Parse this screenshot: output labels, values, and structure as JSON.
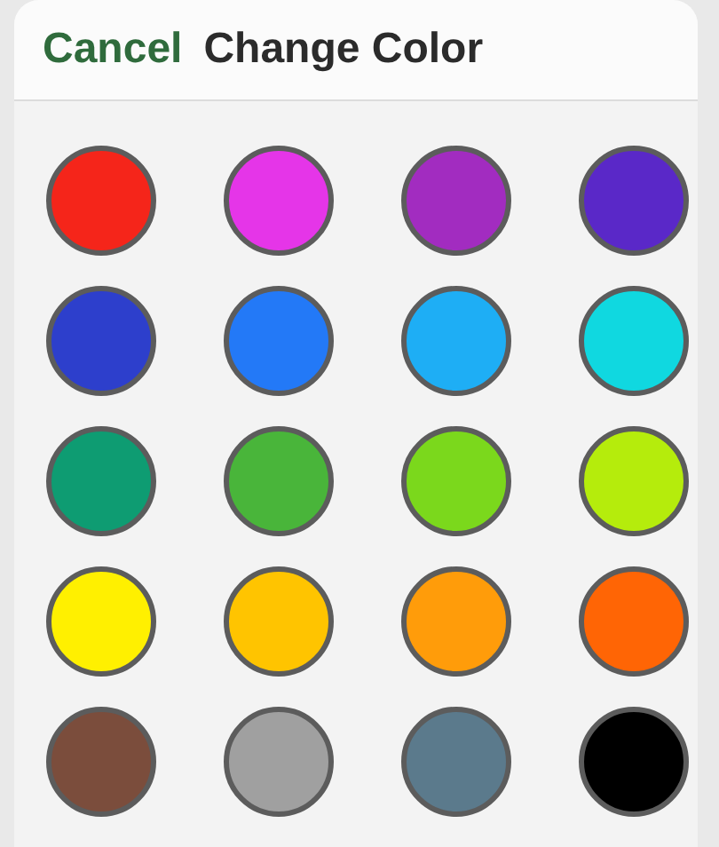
{
  "header": {
    "cancel": "Cancel",
    "title": "Change Color"
  },
  "swatches": [
    {
      "color": "#f5251a"
    },
    {
      "color": "#e535e8"
    },
    {
      "color": "#a22cc0"
    },
    {
      "color": "#5a28c8"
    },
    {
      "color": "#2d3fcc"
    },
    {
      "color": "#2379f7"
    },
    {
      "color": "#1eaef5"
    },
    {
      "color": "#10d8e0"
    },
    {
      "color": "#0e9c72"
    },
    {
      "color": "#49b53a"
    },
    {
      "color": "#7bd81c"
    },
    {
      "color": "#b5ec0c"
    },
    {
      "color": "#fff000"
    },
    {
      "color": "#ffc400"
    },
    {
      "color": "#ff9c0a"
    },
    {
      "color": "#ff6505"
    },
    {
      "color": "#7b4d3c"
    },
    {
      "color": "#a0a0a0"
    },
    {
      "color": "#5b7a8c"
    },
    {
      "color": "#000000"
    }
  ]
}
